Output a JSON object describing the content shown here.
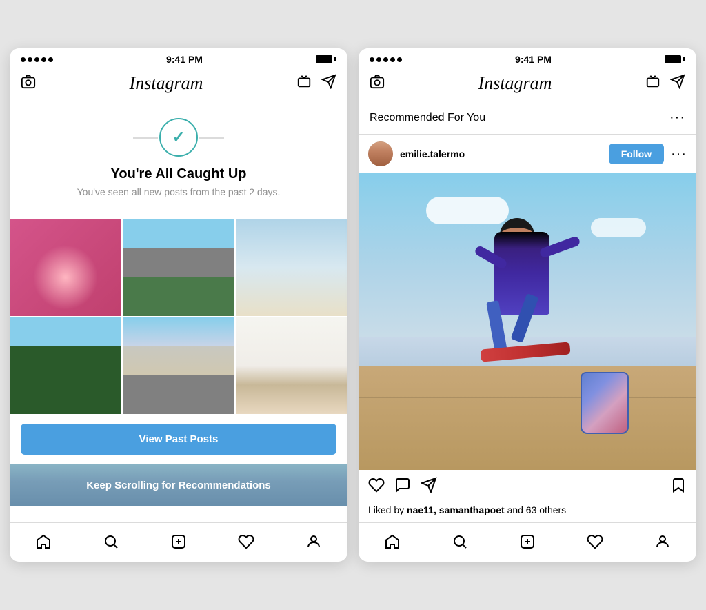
{
  "phone1": {
    "statusBar": {
      "time": "9:41 PM"
    },
    "navBar": {
      "logo": "Instagram"
    },
    "caughtUp": {
      "title": "You're All Caught Up",
      "subtitle": "You've seen all new posts from the past 2 days.",
      "viewPastLabel": "View Past Posts",
      "keepScrollingLabel": "Keep Scrolling for Recommendations"
    },
    "bottomNav": {
      "items": [
        "home",
        "search",
        "add",
        "heart",
        "profile"
      ]
    }
  },
  "phone2": {
    "statusBar": {
      "time": "9:41 PM"
    },
    "navBar": {
      "logo": "Instagram"
    },
    "recommendedSection": {
      "title": "Recommended For You"
    },
    "post": {
      "username": "emilie.talermo",
      "followLabel": "Follow",
      "likesText": "Liked by ",
      "likedBy": "nae11, samanthapoet",
      "othersCount": "and 63 others"
    },
    "bottomNav": {
      "items": [
        "home",
        "search",
        "add",
        "heart",
        "profile"
      ]
    }
  }
}
